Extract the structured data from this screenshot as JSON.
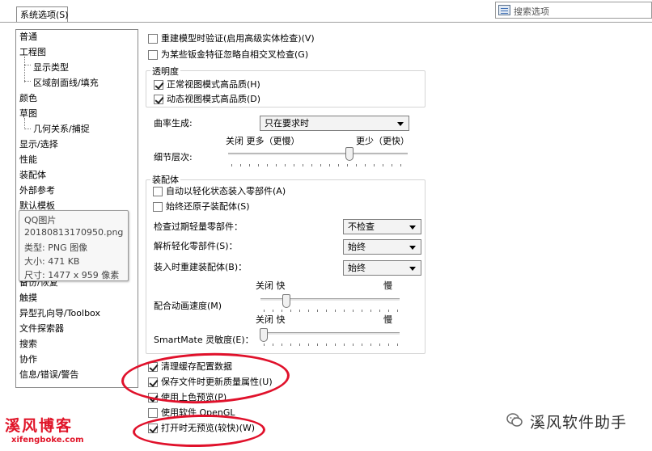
{
  "tab": {
    "label": "系统选项(S)"
  },
  "search": {
    "placeholder": "搜索选项"
  },
  "tree": {
    "items": [
      {
        "label": "普通"
      },
      {
        "label": "工程图"
      },
      {
        "label": "显示类型"
      },
      {
        "label": "区域剖面线/填充"
      },
      {
        "label": "颜色"
      },
      {
        "label": "草图"
      },
      {
        "label": "几何关系/捕捉"
      },
      {
        "label": "显示/选择"
      },
      {
        "label": "性能"
      },
      {
        "label": "装配体"
      },
      {
        "label": "外部参考"
      },
      {
        "label": "默认模板"
      },
      {
        "label": "备份/恢复"
      },
      {
        "label": "触摸"
      },
      {
        "label": "异型孔向导/Toolbox"
      },
      {
        "label": "文件探索器"
      },
      {
        "label": "搜索"
      },
      {
        "label": "协作"
      },
      {
        "label": "信息/错误/警告"
      }
    ]
  },
  "tooltip": {
    "name": "QQ图片",
    "file": "20180813170950.png",
    "type": "类型: PNG 图像",
    "size": "大小: 471 KB",
    "dims": "尺寸: 1477 x 959 像素"
  },
  "options": {
    "rebuild_verify": {
      "label": "重建模型时验证(启用高级实体检查)(V)",
      "checked": false
    },
    "ignore_self_intersect": {
      "label": "为某些钣金特征忽略自相交叉检查(G)",
      "checked": false
    },
    "transparency": {
      "title": "透明度",
      "normal_hq": {
        "label": "正常视图模式高品质(H)",
        "checked": true
      },
      "dynamic_hq": {
        "label": "动态视图模式高品质(D)",
        "checked": true
      }
    },
    "curvature": {
      "label": "曲率生成:",
      "value": "只在要求时"
    },
    "detail": {
      "label": "细节层次:",
      "left_caption": "关闭 更多（更慢）",
      "right_caption": "更少（更快）",
      "level": 0.55
    },
    "assembly": {
      "title": "装配体",
      "auto_lightweight": {
        "label": "自动以轻化状态装入零部件(A)",
        "checked": false
      },
      "always_resolve": {
        "label": "始终还原子装配体(S)",
        "checked": false
      },
      "check_outdated": {
        "label": "检查过期轻量零部件：",
        "value": "不检查"
      },
      "resolve_lightweight": {
        "label": "解析轻化零部件(S)：",
        "value": "始终"
      },
      "rebuild_on_load": {
        "label": "装入时重建装配体(B)：",
        "value": "始终"
      },
      "mate_animation": {
        "label": "配合动画速度(M)",
        "left_caption": "关闭 快",
        "right_caption": "慢",
        "level": 0.2
      },
      "smartmate": {
        "label": "SmartMate 灵敏度(E)：",
        "left_caption": "关闭 快",
        "right_caption": "慢",
        "level": 0.0
      }
    },
    "purge_cache": {
      "label": "清理缓存配置数据",
      "checked": true
    },
    "update_mass_props": {
      "label": "保存文件时更新质量属性(U)",
      "checked": true
    },
    "color_preview": {
      "label": "使用上色预览(P)",
      "checked": true
    },
    "opengl": {
      "label": "使用软件 OpenGL",
      "checked": false
    },
    "no_preview": {
      "label": "打开时无预览(较快)(W)",
      "checked": true
    }
  },
  "watermark": {
    "logo": "溪风博客",
    "url": "xifengboke.com",
    "brand": "溪风软件助手"
  },
  "colors": {
    "annotation_red": "#e0112b",
    "logo_red": "#e01428"
  }
}
